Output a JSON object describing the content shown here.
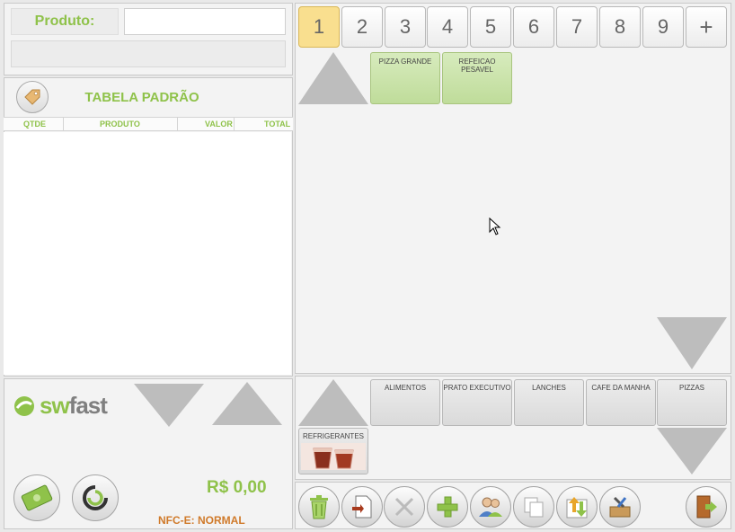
{
  "product": {
    "label": "Produto:",
    "value": ""
  },
  "table": {
    "title": "TABELA PADRÃO",
    "columns": [
      "QTDE",
      "PRODUTO",
      "VALOR",
      "TOTAL"
    ]
  },
  "brand": {
    "prefix": "sw",
    "suffix": "fast"
  },
  "summary": {
    "total": "R$ 0,00",
    "mode": "NFC-E: NORMAL"
  },
  "tabs": [
    "1",
    "2",
    "3",
    "4",
    "5",
    "6",
    "7",
    "8",
    "9",
    "+"
  ],
  "products": [
    "PIZZA GRANDE",
    "REFEICAO PESAVEL"
  ],
  "categories": [
    "ALIMENTOS",
    "PRATO EXECUTIVO",
    "LANCHES",
    "CAFE DA MANHA",
    "PIZZAS",
    "REFRIGERANTES"
  ],
  "icons": {
    "tag": "tag-icon",
    "money": "cash-icon",
    "spinner": "refresh-icon",
    "trash": "trash-icon",
    "doc": "document-icon",
    "cutlery": "cutlery-icon",
    "add": "plus-icon",
    "users": "users-icon",
    "copy": "copy-icon",
    "transfer": "transfer-icon",
    "tools": "tools-icon",
    "exit": "exit-icon"
  },
  "colors": {
    "accent": "#8fc24a",
    "active_tab": "#f9df8f",
    "nfce": "#d07a2a"
  }
}
